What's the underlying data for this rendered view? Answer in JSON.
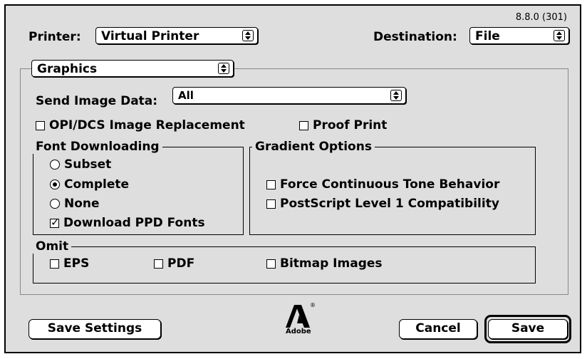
{
  "version": "8.8.0 (301)",
  "printer": {
    "label": "Printer:",
    "value": "Virtual Printer"
  },
  "destination": {
    "label": "Destination:",
    "value": "File"
  },
  "panel": {
    "value": "Graphics"
  },
  "send_image_data": {
    "label": "Send Image Data:",
    "value": "All"
  },
  "opi_dcs": {
    "label": "OPI/DCS Image Replacement",
    "checked": false
  },
  "proof_print": {
    "label": "Proof Print",
    "checked": false
  },
  "font_downloading": {
    "title": "Font Downloading",
    "options": [
      "Subset",
      "Complete",
      "None"
    ],
    "selected": "Complete",
    "download_ppd": {
      "label": "Download PPD Fonts",
      "checked": true
    }
  },
  "gradient_options": {
    "title": "Gradient Options",
    "force_continuous": {
      "label": "Force Continuous Tone Behavior",
      "checked": false
    },
    "ps_level1": {
      "label": "PostScript Level 1 Compatibility",
      "checked": false
    }
  },
  "omit": {
    "title": "Omit",
    "eps": {
      "label": "EPS",
      "checked": false
    },
    "pdf": {
      "label": "PDF",
      "checked": false
    },
    "bitmap": {
      "label": "Bitmap Images",
      "checked": false
    }
  },
  "buttons": {
    "save_settings": "Save Settings",
    "cancel": "Cancel",
    "save": "Save"
  },
  "logo": {
    "text": "Adobe",
    "registered": "®"
  }
}
